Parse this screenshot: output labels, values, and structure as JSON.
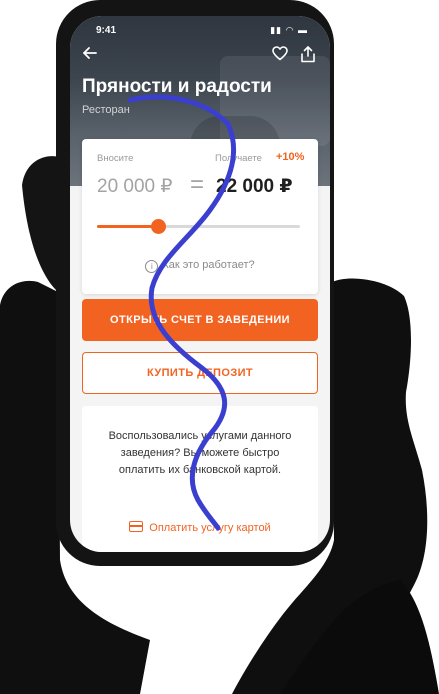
{
  "status_bar": {
    "time": "9:41",
    "icons": "▮▮ ◠ ▬"
  },
  "header": {
    "back_icon": "arrow-left-icon",
    "title": "Пряности и радости",
    "subtitle": "Ресторан",
    "favorite_icon": "heart-icon",
    "share_icon": "share-icon"
  },
  "calculator": {
    "pay_label": "Вносите",
    "get_label": "Получаете",
    "bonus": "+10%",
    "pay_amount": "20 000 ₽",
    "equals": "=",
    "get_amount": "22 000 ₽",
    "slider_level": 0.3,
    "help_text": "Как это работает?"
  },
  "actions": {
    "open_account": "ОТКРЫТЬ СЧЕТ В ЗАВЕДЕНИИ",
    "buy_deposit": "КУПИТЬ ДЕПОЗИТ"
  },
  "info": {
    "text": "Воспользовались услугами данного заведения? Вы можете быстро оплатить их банковской картой.",
    "pay_by_card": "Оплатить услугу картой"
  },
  "colors": {
    "accent": "#f26322",
    "scribble": "#3b3fcf",
    "hand": "#0f0f0f"
  }
}
